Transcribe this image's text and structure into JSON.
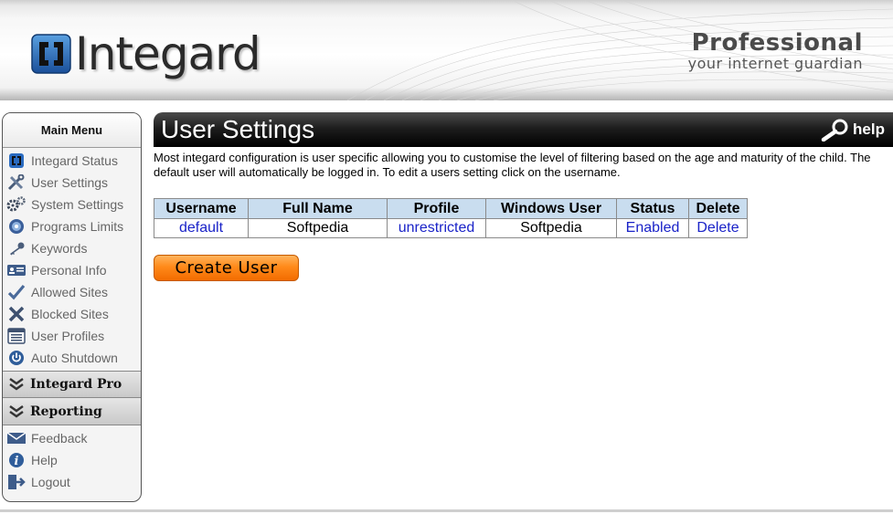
{
  "header": {
    "logo_text": "Integard",
    "edition": "Professional",
    "tagline": "your internet guardian"
  },
  "sidebar": {
    "title": "Main Menu",
    "items": [
      {
        "label": "Integard Status",
        "icon": "status-icon"
      },
      {
        "label": "User Settings",
        "icon": "tools-icon"
      },
      {
        "label": "System Settings",
        "icon": "gears-icon"
      },
      {
        "label": "Programs Limits",
        "icon": "disc-icon"
      },
      {
        "label": "Keywords",
        "icon": "key-icon"
      },
      {
        "label": "Personal Info",
        "icon": "id-card-icon"
      },
      {
        "label": "Allowed Sites",
        "icon": "checkmark-icon"
      },
      {
        "label": "Blocked Sites",
        "icon": "x-mark-icon"
      },
      {
        "label": "User Profiles",
        "icon": "profiles-icon"
      },
      {
        "label": "Auto Shutdown",
        "icon": "power-icon"
      }
    ],
    "sections": [
      {
        "label": "Integard Pro"
      },
      {
        "label": "Reporting"
      }
    ],
    "bottom_items": [
      {
        "label": "Feedback",
        "icon": "envelope-icon"
      },
      {
        "label": "Help",
        "icon": "info-icon"
      },
      {
        "label": "Logout",
        "icon": "logout-icon"
      }
    ]
  },
  "main": {
    "title": "User Settings",
    "help_label": "help",
    "intro": "Most integard configuration is user specific allowing you to customise the level of filtering based on the age and maturity of the child. The default user will automatically be logged in. To edit a users setting click on the username.",
    "table": {
      "columns": [
        "Username",
        "Full Name",
        "Profile",
        "Windows User",
        "Status",
        "Delete"
      ],
      "rows": [
        {
          "username": "default",
          "full_name": "Softpedia",
          "profile": "unrestricted",
          "windows_user": "Softpedia",
          "status": "Enabled",
          "delete": "Delete"
        }
      ]
    },
    "create_user_label": "Create User"
  },
  "colors": {
    "title_bar": "#000000",
    "table_header": "#c9ddef",
    "link": "#1a23c8",
    "button_orange": "#ff8a1a"
  }
}
